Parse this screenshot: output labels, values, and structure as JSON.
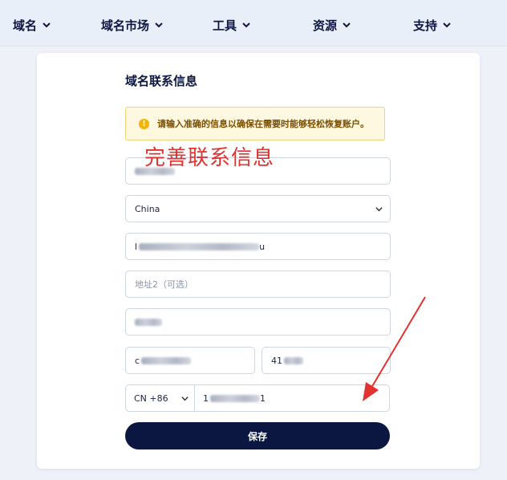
{
  "nav": {
    "items": [
      {
        "label": "域名"
      },
      {
        "label": "域名市场"
      },
      {
        "label": "工具"
      },
      {
        "label": "资源"
      },
      {
        "label": "支持"
      }
    ]
  },
  "form": {
    "title": "域名联系信息",
    "alert": "请输入准确的信息以确保在需要时能够轻松恢复账户。",
    "country_value": "China",
    "address_prefix": "l",
    "address_suffix": "u",
    "address2_placeholder": "地址2（可选）",
    "postcode_prefix": "41",
    "city_prefix": "c",
    "phone_code": "CN +86",
    "phone_prefix": "1",
    "phone_suffix": "1",
    "save_label": "保存"
  },
  "annotation": {
    "text": "完善联系信息",
    "color": "#e2322f"
  },
  "colors": {
    "brand_dark": "#0b1741",
    "alert_bg": "#fff8e1",
    "alert_border": "#f2d27a",
    "alert_icon": "#f4b400",
    "nav_bg": "#e9eff9"
  }
}
